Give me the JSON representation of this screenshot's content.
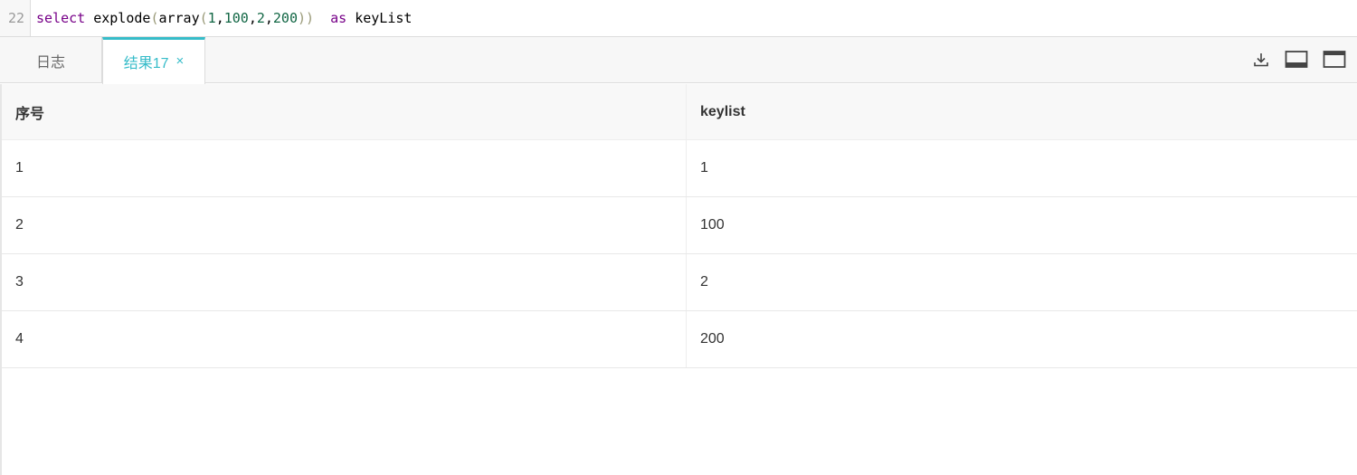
{
  "editor": {
    "line_number": "22",
    "tokens": {
      "select": "select",
      "func": "explode",
      "paren_open": "(",
      "array": "array",
      "n1": "1",
      "comma1": ",",
      "n2": "100",
      "comma2": ",",
      "n3": "2",
      "comma3": ",",
      "n4": "200",
      "paren_close": "))",
      "as": "as",
      "alias": "keyList"
    }
  },
  "tabs": {
    "log_label": "日志",
    "result_label": "结果17",
    "result_close": "×"
  },
  "toolbar": {
    "icons": [
      "download-icon",
      "panel-bottom-icon",
      "window-maximize-icon"
    ]
  },
  "table": {
    "columns": [
      "序号",
      "keylist"
    ],
    "rows": [
      [
        "1",
        "1"
      ],
      [
        "2",
        "100"
      ],
      [
        "3",
        "2"
      ],
      [
        "4",
        "200"
      ]
    ]
  },
  "colors": {
    "accent": "#36bcc9",
    "keyword": "#770088",
    "number": "#116644"
  }
}
